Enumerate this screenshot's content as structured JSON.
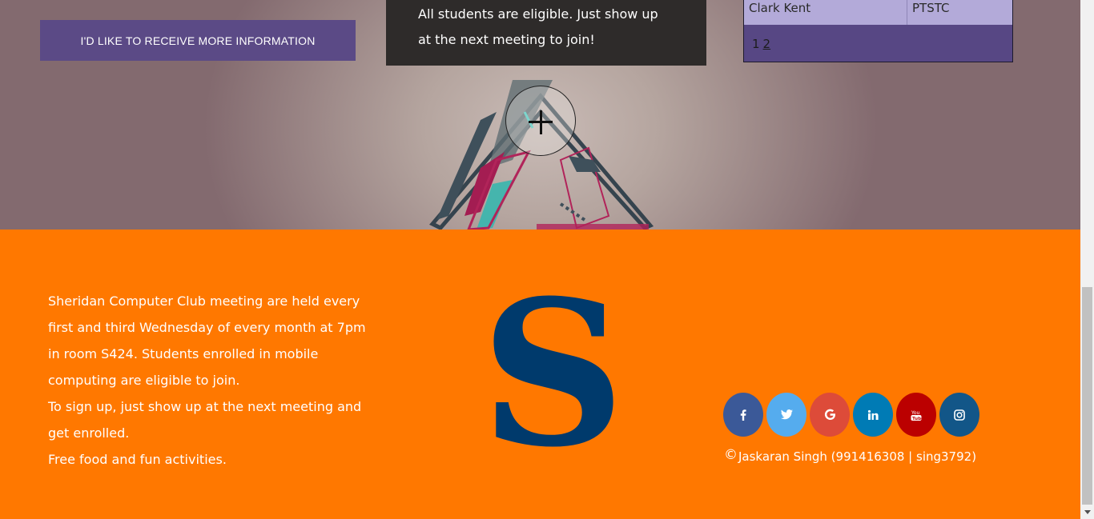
{
  "hero": {
    "info_button_label": "I'D LIKE TO RECEIVE MORE INFORMATION",
    "eligibility_text": "All students are eligible. Just show up at the next meeting to join!",
    "members_table": {
      "row": [
        "Clark Kent",
        "PTSTC"
      ],
      "pager_current": "1",
      "pager_next": "2"
    }
  },
  "footer": {
    "paragraphs": [
      "Sheridan Computer Club meeting are held every first and third Wednesday of every month at 7pm in room S424. Students enrolled in mobile computing are eligible to join.",
      "To sign up, just show up at the next meeting and get enrolled.",
      "Free food and fun activities."
    ],
    "logo_letter": "S",
    "copyright_symbol": "©",
    "copyright_text": "Jaskaran Singh (991416308 | sing3792)",
    "social": [
      {
        "icon": "facebook-icon",
        "color": "#3b5998"
      },
      {
        "icon": "twitter-icon",
        "color": "#55acee"
      },
      {
        "icon": "google-icon",
        "color": "#dd4b39"
      },
      {
        "icon": "linkedin-icon",
        "color": "#007bb5"
      },
      {
        "icon": "youtube-icon",
        "color": "#bb0000"
      },
      {
        "icon": "instagram-icon",
        "color": "#125688"
      }
    ]
  },
  "colors": {
    "footer_bg": "#ff7800",
    "button_bg": "#5b4a86",
    "logo": "#003a6c"
  }
}
